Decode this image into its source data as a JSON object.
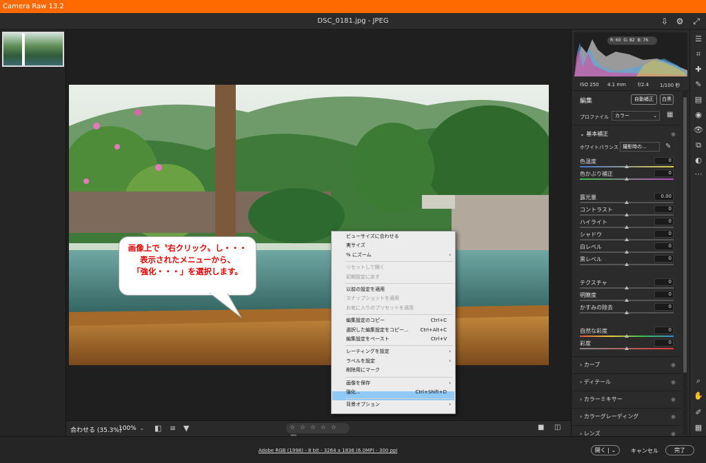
{
  "app": {
    "title": "Camera Raw 13.2",
    "filename": "DSC_0181.jpg  -  JPEG"
  },
  "histogram": {
    "r_label": "R: 60",
    "g_label": "G: 82",
    "b_label": "B: 76"
  },
  "camera_info": {
    "iso": "ISO 250",
    "focal": "4.1 mm",
    "aperture": "f/2.4",
    "shutter": "1/100 秒"
  },
  "edit": {
    "title": "編集",
    "auto_label": "自動補正",
    "bw_label": "白黒",
    "profile_label": "プロファイル",
    "profile_value": "カラー",
    "basic_title": "基本補正",
    "wb_label": "ホワイトバランス",
    "wb_value": "撮影時の...",
    "sliders": [
      {
        "label": "色温度",
        "value": "0",
        "pos": 0.5
      },
      {
        "label": "色かぶり補正",
        "value": "0",
        "pos": 0.5
      },
      {
        "label": "露光量",
        "value": "0.00",
        "pos": 0.5
      },
      {
        "label": "コントラスト",
        "value": "0",
        "pos": 0.5
      },
      {
        "label": "ハイライト",
        "value": "0",
        "pos": 0.5
      },
      {
        "label": "シャドウ",
        "value": "0",
        "pos": 0.5
      },
      {
        "label": "白レベル",
        "value": "0",
        "pos": 0.5
      },
      {
        "label": "黒レベル",
        "value": "0",
        "pos": 0.5
      },
      {
        "label": "テクスチャ",
        "value": "0",
        "pos": 0.5
      },
      {
        "label": "明瞭度",
        "value": "0",
        "pos": 0.5
      },
      {
        "label": "かすみの除去",
        "value": "0",
        "pos": 0.5
      },
      {
        "label": "自然な彩度",
        "value": "0",
        "pos": 0.5
      },
      {
        "label": "彩度",
        "value": "0",
        "pos": 0.5
      }
    ],
    "sections": [
      "カーブ",
      "ディテール",
      "カラーミキサー",
      "カラーグレーディング",
      "レンズ"
    ]
  },
  "context_menu": {
    "items": [
      {
        "label": "ビューサイズに合わせる"
      },
      {
        "label": "実サイズ"
      },
      {
        "label": "% にズーム",
        "arrow": "›"
      },
      {
        "label": "リセットして開く",
        "disabled": true
      },
      {
        "label": "初期設定に戻す",
        "disabled": true
      },
      {
        "label": "以前の設定を適用"
      },
      {
        "label": "スナップショットを適用",
        "disabled": true
      },
      {
        "label": "お気に入りのプリセットを適用",
        "disabled": true
      },
      {
        "label": "編集設定のコピー",
        "shortcut": "Ctrl+C"
      },
      {
        "label": "選択した編集設定をコピー...",
        "shortcut": "Ctrl+Alt+C"
      },
      {
        "label": "編集設定をペースト",
        "shortcut": "Ctrl+V"
      },
      {
        "label": "レーティングを設定",
        "arrow": "›"
      },
      {
        "label": "ラベルを設定",
        "arrow": "›"
      },
      {
        "label": "削除用にマーク"
      },
      {
        "label": "画像を保存",
        "arrow": "›"
      },
      {
        "label": "強化...",
        "shortcut": "Ctrl+Shift+D"
      },
      {
        "label": "背景オプション",
        "arrow": "›"
      }
    ]
  },
  "callout": {
    "line1": "画像上で〝右クリック〟し・・・",
    "line2": "表示されたメニューから、",
    "line3": "「強化・・・」を選択します。"
  },
  "bottom": {
    "fit_label": "合わせる (35.3%)",
    "zoom_label": "100%",
    "stars": "☆ ☆ ☆ ☆ ☆"
  },
  "footer": {
    "info_link": "Adobe RGB (1998) - 8 bit - 3264 x 1836 (6.0MP) - 300 ppi",
    "open_label": "開く",
    "cancel_label": "キャンセル",
    "done_label": "完了"
  }
}
